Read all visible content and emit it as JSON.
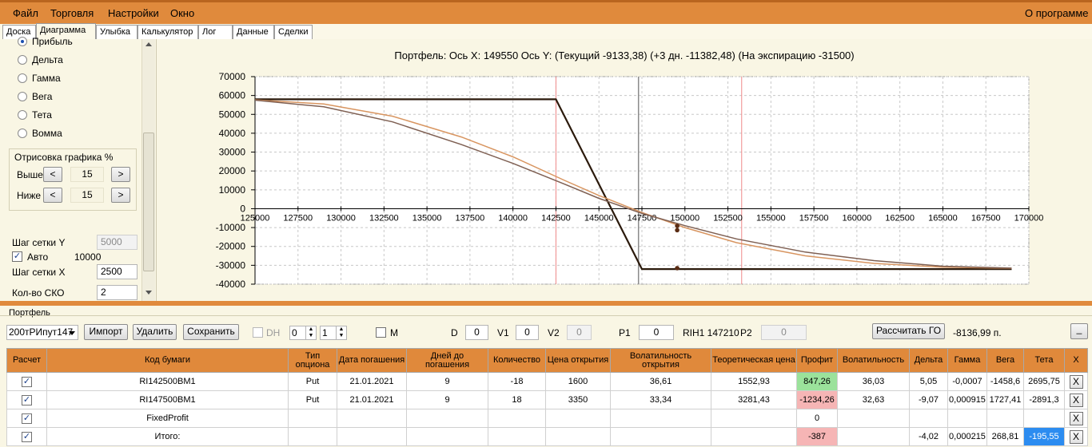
{
  "menu": {
    "file": "Файл",
    "trade": "Торговля",
    "settings": "Настройки",
    "window": "Окно",
    "about": "О программе"
  },
  "tabs": [
    "Доска",
    "Диаграмма",
    "Улыбка",
    "Калькулятор",
    "Лог",
    "Данные",
    "Сделки"
  ],
  "left": {
    "radios": [
      "Прибыль",
      "Дельта",
      "Гамма",
      "Вега",
      "Тета",
      "Вомма"
    ],
    "draw_group": "Отрисовка графика %",
    "above_label": "Выше",
    "above_value": "15",
    "below_label": "Ниже",
    "below_value": "15",
    "btn_less": "<",
    "btn_more": ">",
    "grid_y_label": "Шаг сетки Y",
    "grid_y_value": "5000",
    "auto_label": "Авто",
    "auto_value": "10000",
    "grid_x_label": "Шаг сетки X",
    "grid_x_value": "2500",
    "sko_label": "Кол-во СКО",
    "sko_value": "2"
  },
  "chart_data": {
    "type": "line",
    "title": "Портфель: Ось X:  149550 Ось Y:   (Текущий -9133,38)  (+3 дн. -11382,48)  (На экспирацию -31500)",
    "xlim": [
      125000,
      170000
    ],
    "ylim": [
      -40000,
      70000
    ],
    "xticks": [
      125000,
      127500,
      130000,
      132500,
      135000,
      137500,
      140000,
      142500,
      145000,
      147500,
      150000,
      152500,
      155000,
      157500,
      160000,
      162500,
      165000,
      167500,
      170000
    ],
    "yticks": [
      70000,
      60000,
      50000,
      40000,
      30000,
      20000,
      10000,
      0,
      -10000,
      -20000,
      -30000,
      -40000
    ],
    "grid": true,
    "series": [
      {
        "values_x": [
          125000,
          142500,
          147500,
          169000
        ],
        "values_y": [
          58000,
          58000,
          -32000,
          -32000
        ],
        "color": "#2b1a0c"
      },
      {
        "values_x": [
          125000,
          129000,
          133000,
          137000,
          140000,
          143000,
          145000,
          147500,
          150000,
          153000,
          157000,
          161000,
          165000,
          169000
        ],
        "values_y": [
          57700,
          55500,
          49000,
          38000,
          27500,
          15000,
          7000,
          -2000,
          -10000,
          -18000,
          -25000,
          -29000,
          -31000,
          -31600
        ],
        "color": "#d89560"
      },
      {
        "values_x": [
          125000,
          129000,
          133000,
          137000,
          140000,
          143000,
          145000,
          147500,
          150000,
          153000,
          157000,
          161000,
          165000,
          169000
        ],
        "values_y": [
          57500,
          54000,
          46000,
          34000,
          24000,
          13000,
          5500,
          -2500,
          -9000,
          -16000,
          -23000,
          -27500,
          -30500,
          -31500
        ],
        "color": "#7e5f52"
      }
    ],
    "markers": [
      {
        "x": 149550,
        "y": -9133
      },
      {
        "x": 149550,
        "y": -11382
      },
      {
        "x": 149550,
        "y": -31500
      }
    ],
    "vlines_red": [
      142500,
      153300
    ],
    "vline_gray": 147300
  },
  "portfolio": {
    "title": "Портфель",
    "portfolio_select": "200тРИпут147",
    "import_btn": "Импорт",
    "delete_btn": "Удалить",
    "save_btn": "Сохранить",
    "dh_label": "DH",
    "spin1": "0",
    "spin2": "1",
    "m_label": "M",
    "d_label": "D",
    "d_value": "0",
    "v1_label": "V1",
    "v1_value": "0",
    "v2_label": "V2",
    "v2_value": "0",
    "p1_label": "P1",
    "p1_value": "0",
    "rih_label": "RIH1 147210",
    "p2_label": "P2",
    "p2_value": "0",
    "calc_go_btn": "Рассчитать ГО",
    "go_value": "-8136,99 п.",
    "min_btn": "_"
  },
  "grid": {
    "headers": [
      "Расчет",
      "Код бумаги",
      "Тип опциона",
      "Дата погашения",
      "Дней до погашения",
      "Количество",
      "Цена открытия",
      "Волатильность открытия",
      "Теоретическая цена",
      "Профит",
      "Волатильность",
      "Дельта",
      "Гамма",
      "Вега",
      "Тета",
      "X"
    ],
    "rows": [
      [
        "RI142500BM1",
        "Put",
        "21.01.2021",
        "9",
        "-18",
        "1600",
        "36,61",
        "1552,93",
        "847,26",
        "36,03",
        "5,05",
        "-0,0007",
        "-1458,6",
        "2695,75"
      ],
      [
        "RI147500BM1",
        "Put",
        "21.01.2021",
        "9",
        "18",
        "3350",
        "33,34",
        "3281,43",
        "-1234,26",
        "32,63",
        "-9,07",
        "0,000915",
        "1727,41",
        "-2891,3"
      ],
      [
        "FixedProfit",
        "",
        "",
        "",
        "",
        "",
        "",
        "",
        "0",
        "",
        "",
        "",
        "",
        ""
      ],
      [
        "Итого:",
        "",
        "",
        "",
        "",
        "",
        "",
        "",
        "-387",
        "",
        "-4,02",
        "0,000215",
        "268,81",
        "-195,55"
      ]
    ],
    "check_mark": "✓",
    "x_label": "X"
  }
}
